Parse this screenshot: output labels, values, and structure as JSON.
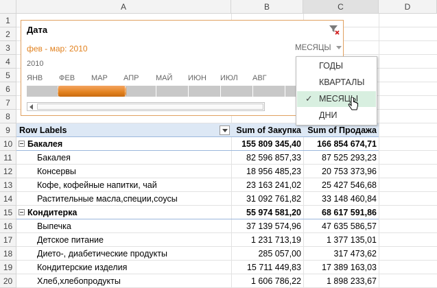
{
  "columns": [
    "A",
    "B",
    "C",
    "D"
  ],
  "rows": [
    "1",
    "2",
    "3",
    "4",
    "5",
    "6",
    "7",
    "8",
    "9",
    "10",
    "11",
    "12",
    "13",
    "14",
    "15",
    "16",
    "17",
    "18",
    "19",
    "20"
  ],
  "timeline": {
    "title": "Дата",
    "range_label": "фев - мар: 2010",
    "level_label": "МЕСЯЦЫ",
    "year": "2010",
    "months": [
      "ЯНВ",
      "ФЕВ",
      "МАР",
      "АПР",
      "МАЙ",
      "ИЮН",
      "ИЮЛ",
      "АВГ"
    ],
    "accent": "#e2821f"
  },
  "dropdown": {
    "items": [
      "ГОДЫ",
      "КВАРТАЛЫ",
      "МЕСЯЦЫ",
      "ДНИ"
    ],
    "selected": "МЕСЯЦЫ",
    "check": "✓"
  },
  "pivot": {
    "headers": [
      "Row Labels",
      "Sum of Закупка",
      "Sum of Продажа"
    ],
    "rows": [
      {
        "label": "Бакалея",
        "buy": "155 809 345,40",
        "sell": "166 854 674,71",
        "group": true
      },
      {
        "label": "Бакалея",
        "buy": "82 596 857,33",
        "sell": "87 525 293,23",
        "group": false
      },
      {
        "label": "Консервы",
        "buy": "18 956 485,23",
        "sell": "20 753 373,96",
        "group": false
      },
      {
        "label": "Кофе, кофейные напитки, чай",
        "buy": "23 163 241,02",
        "sell": "25 427 546,68",
        "group": false
      },
      {
        "label": "Растительные масла,специи,соусы",
        "buy": "31 092 761,82",
        "sell": "33 148 460,84",
        "group": false
      },
      {
        "label": "Кондитерка",
        "buy": "55 974 581,20",
        "sell": "68 617 591,86",
        "group": true
      },
      {
        "label": "Выпечка",
        "buy": "37 139 574,96",
        "sell": "47 635 586,57",
        "group": false
      },
      {
        "label": "Детское питание",
        "buy": "1 231 713,19",
        "sell": "1 377 135,01",
        "group": false
      },
      {
        "label": "Дието-, диабетические продукты",
        "buy": "285 057,00",
        "sell": "317 473,62",
        "group": false
      },
      {
        "label": "Кондитерские изделия",
        "buy": "15 711 449,83",
        "sell": "17 389 163,03",
        "group": false
      },
      {
        "label": "Хлеб,хлебопродукты",
        "buy": "1 606 786,22",
        "sell": "1 898 233,67",
        "group": false
      }
    ]
  }
}
